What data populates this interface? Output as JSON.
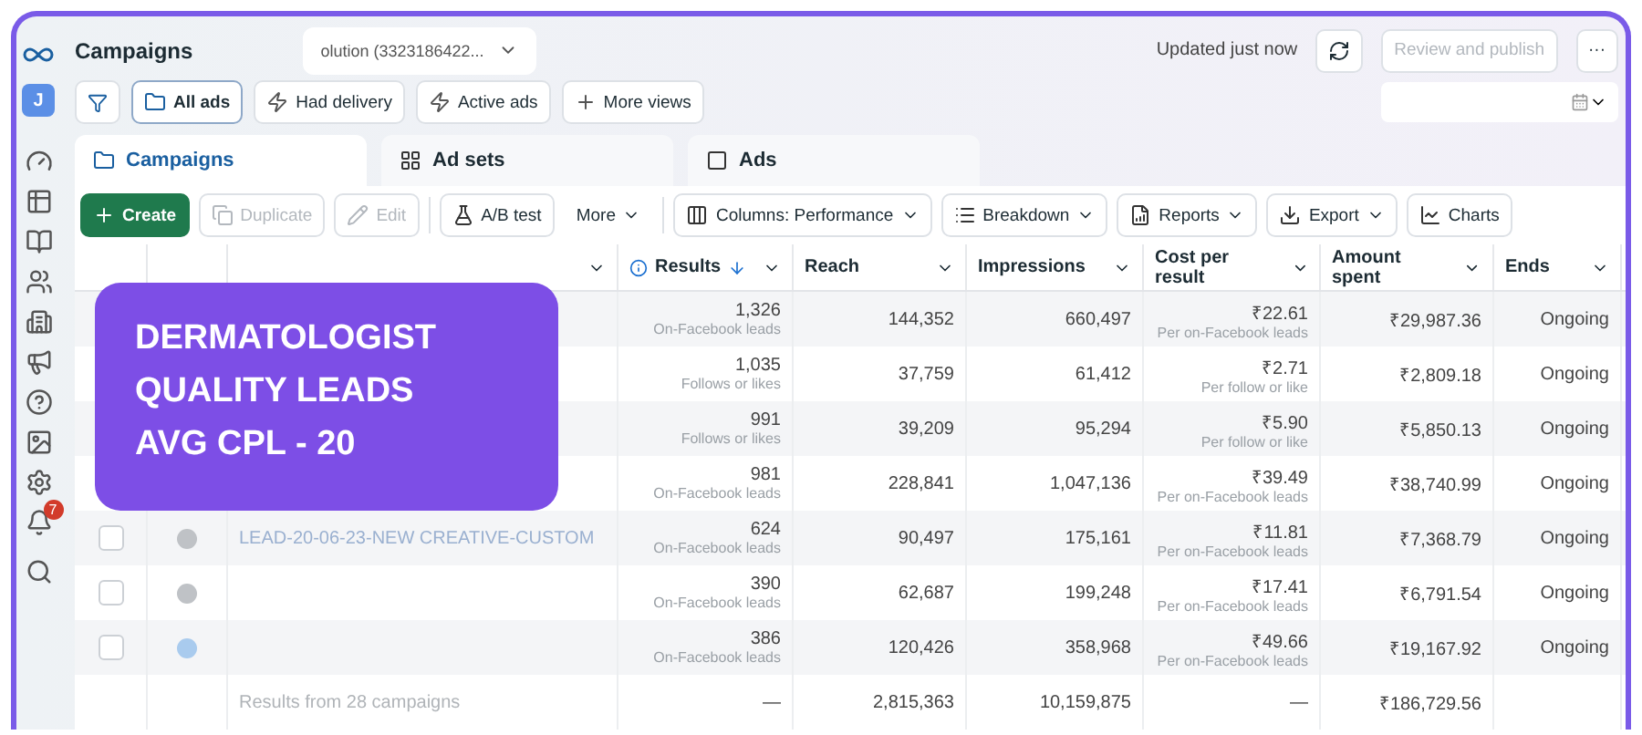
{
  "header": {
    "title": "Campaigns",
    "account": "olution (3323186422...",
    "status": "Updated just now",
    "publish": "Review and publish",
    "more": "···"
  },
  "views": [
    {
      "label": "All ads",
      "selected": true
    },
    {
      "label": "Had delivery",
      "selected": false
    },
    {
      "label": "Active ads",
      "selected": false
    },
    {
      "label": "More views",
      "selected": false
    }
  ],
  "tabs": [
    {
      "label": "Campaigns",
      "selected": true
    },
    {
      "label": "Ad sets",
      "selected": false
    },
    {
      "label": "Ads",
      "selected": false
    }
  ],
  "toolbar": [
    {
      "label": "Create",
      "kind": "primary",
      "disabled": false
    },
    {
      "label": "Duplicate",
      "kind": "plain",
      "disabled": true
    },
    {
      "label": "Edit",
      "kind": "plain",
      "disabled": true
    },
    {
      "label": "A/B test",
      "kind": "plain",
      "disabled": false
    },
    {
      "label": "More",
      "kind": "menu",
      "disabled": false
    },
    {
      "label": "Columns: Performance",
      "kind": "dropdown",
      "disabled": false
    },
    {
      "label": "Breakdown",
      "kind": "dropdown",
      "disabled": false
    },
    {
      "label": "Reports",
      "kind": "dropdown",
      "disabled": false
    },
    {
      "label": "Export",
      "kind": "dropdown",
      "disabled": false
    },
    {
      "label": "Charts",
      "kind": "plain",
      "disabled": false
    }
  ],
  "table": {
    "columns": [
      "Results",
      "Reach",
      "Impressions",
      "Cost per result",
      "Amount spent",
      "Ends"
    ],
    "rows": [
      {
        "results": "1,326",
        "results_label": "On-Facebook leads",
        "reach": "144,352",
        "impressions": "660,497",
        "cost": "₹22.61",
        "cost_label": "Per on-Facebook leads",
        "amount": "₹29,987.36",
        "ends": "Ongoing"
      },
      {
        "results": "1,035",
        "results_label": "Follows or likes",
        "reach": "37,759",
        "impressions": "61,412",
        "cost": "₹2.71",
        "cost_label": "Per follow or like",
        "amount": "₹2,809.18",
        "ends": "Ongoing"
      },
      {
        "results": "991",
        "results_label": "Follows or likes",
        "reach": "39,209",
        "impressions": "95,294",
        "cost": "₹5.90",
        "cost_label": "Per follow or like",
        "amount": "₹5,850.13",
        "ends": "Ongoing"
      },
      {
        "results": "981",
        "results_label": "On-Facebook leads",
        "reach": "228,841",
        "impressions": "1,047,136",
        "cost": "₹39.49",
        "cost_label": "Per on-Facebook leads",
        "amount": "₹38,740.99",
        "ends": "Ongoing"
      },
      {
        "name": "LEAD-20-06-23-NEW CREATIVE-CUSTOM",
        "checked": false,
        "on": false,
        "results": "624",
        "results_label": "On-Facebook leads",
        "reach": "90,497",
        "impressions": "175,161",
        "cost": "₹11.81",
        "cost_label": "Per on-Facebook leads",
        "amount": "₹7,368.79",
        "ends": "Ongoing"
      },
      {
        "checked": false,
        "on": false,
        "results": "390",
        "results_label": "On-Facebook leads",
        "reach": "62,687",
        "impressions": "199,248",
        "cost": "₹17.41",
        "cost_label": "Per on-Facebook leads",
        "amount": "₹6,791.54",
        "ends": "Ongoing"
      },
      {
        "checked": false,
        "on": true,
        "results": "386",
        "results_label": "On-Facebook leads",
        "reach": "120,426",
        "impressions": "358,968",
        "cost": "₹49.66",
        "cost_label": "Per on-Facebook leads",
        "amount": "₹19,167.92",
        "ends": "Ongoing"
      }
    ],
    "summary": {
      "name": "Results from 28 campaigns",
      "results": "—",
      "reach": "2,815,363",
      "impressions": "10,159,875",
      "cost": "—",
      "amount": "₹186,729.56"
    }
  },
  "sidebar": {
    "avatar": "J",
    "badge": "7"
  },
  "overlay": {
    "lines": [
      "DERMATOLOGIST",
      "QUALITY LEADS",
      "AVG CPL - 20"
    ]
  }
}
